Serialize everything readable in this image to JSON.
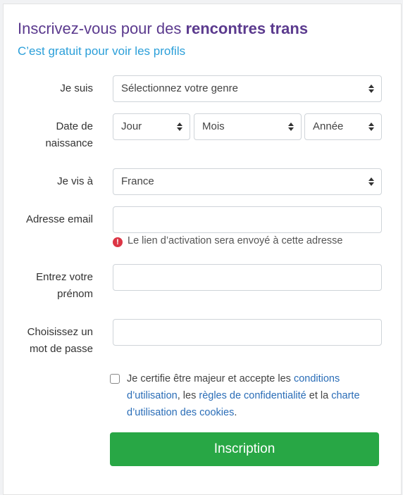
{
  "header": {
    "title_regular": "Inscrivez-vous pour des ",
    "title_bold": "rencontres trans",
    "subtitle": "C’est gratuit pour voir les profils"
  },
  "form": {
    "gender": {
      "label": "Je suis",
      "value": "Sélectionnez votre genre"
    },
    "birth": {
      "label_line1": "Date de",
      "label_line2": "naissance",
      "day": "Jour",
      "month": "Mois",
      "year": "Année"
    },
    "country": {
      "label": "Je vis à",
      "value": "France"
    },
    "email": {
      "label": "Adresse email",
      "value": "",
      "hint": "Le lien d’activation sera envoyé à cette adresse",
      "hint_icon": "error-circle-icon"
    },
    "firstname": {
      "label_line1": "Entrez votre",
      "label_line2": "prénom",
      "value": ""
    },
    "password": {
      "label_line1": "Choisissez un",
      "label_line2": "mot de passe",
      "value": ""
    },
    "terms": {
      "text_1": "Je certifie être majeur et accepte les ",
      "link_conditions": "conditions d’utilisation",
      "text_2": ", les ",
      "link_privacy": "règles de confidentialité",
      "text_3": " et la ",
      "link_cookies": "charte d’utilisation des cookies",
      "text_4": ".",
      "checked": false
    },
    "submit_label": "Inscription"
  },
  "colors": {
    "title": "#5b3a8e",
    "subtitle": "#2b9fd9",
    "link": "#2a6db7",
    "button": "#28a745",
    "error": "#dc3545"
  }
}
